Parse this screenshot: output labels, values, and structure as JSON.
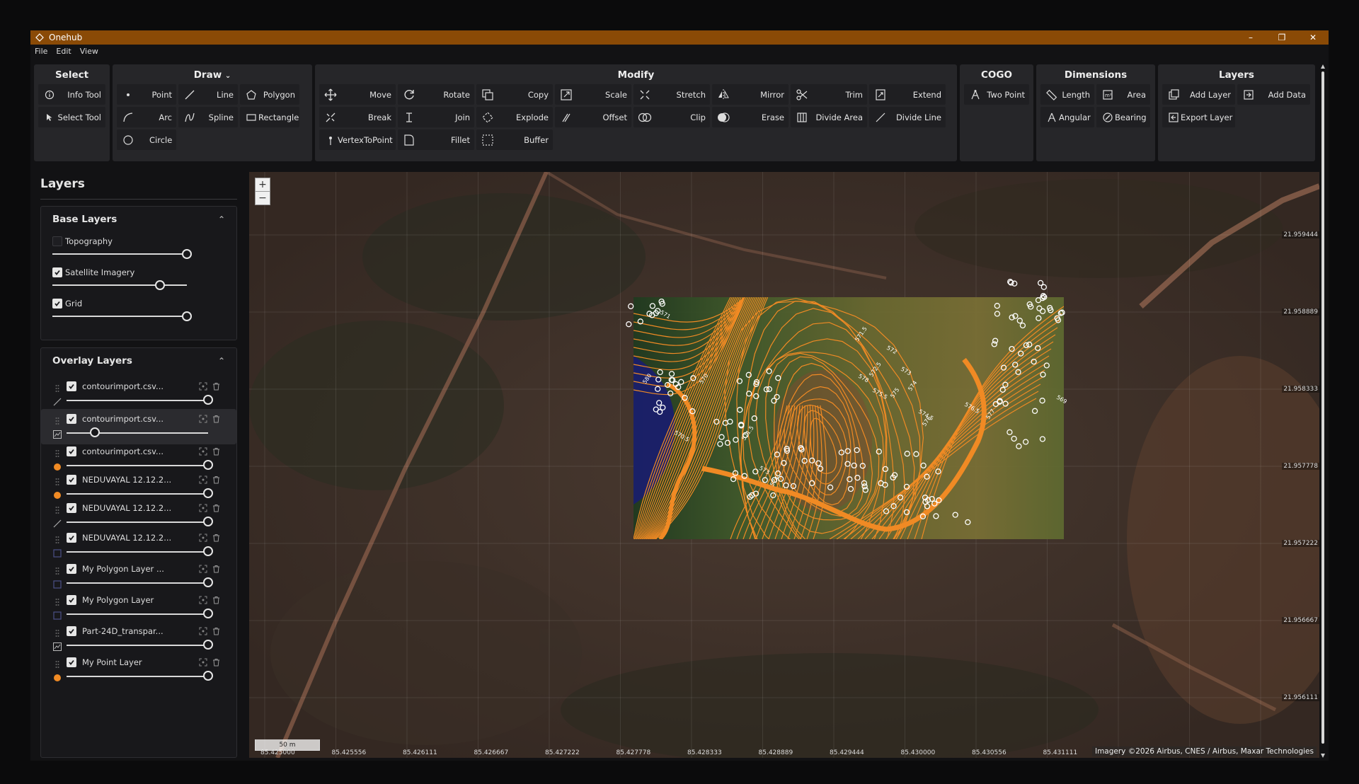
{
  "window": {
    "title": "Onehub",
    "minimize": "–",
    "maximize": "❐",
    "close": "✕"
  },
  "menu": [
    "File",
    "Edit",
    "View"
  ],
  "ribbon": {
    "select": {
      "title": "Select",
      "buttons": [
        "Info Tool",
        "Select Tool"
      ]
    },
    "draw": {
      "title": "Draw",
      "buttons": [
        "Point",
        "Line",
        "Polygon",
        "Arc",
        "Spline",
        "Rectangle",
        "Circle"
      ]
    },
    "modify": {
      "title": "Modify",
      "buttons": [
        "Move",
        "Rotate",
        "Copy",
        "Scale",
        "Stretch",
        "Mirror",
        "Trim",
        "Extend",
        "Break",
        "Join",
        "Explode",
        "Offset",
        "Clip",
        "Erase",
        "Divide Area",
        "Divide Line",
        "VertexToPoint",
        "Fillet",
        "Buffer"
      ]
    },
    "cogo": {
      "title": "COGO",
      "buttons": [
        "Two Point"
      ]
    },
    "dimensions": {
      "title": "Dimensions",
      "buttons": [
        "Length",
        "Area",
        "Angular",
        "Bearing"
      ]
    },
    "layers": {
      "title": "Layers",
      "buttons": [
        "Add Layer",
        "Add Data",
        "Export Layer"
      ]
    }
  },
  "sidebar": {
    "title": "Layers",
    "base": {
      "title": "Base Layers",
      "items": [
        {
          "label": "Topography",
          "checked": false,
          "opacity": 1.0
        },
        {
          "label": "Satellite Imagery",
          "checked": true,
          "opacity": 0.8
        },
        {
          "label": "Grid",
          "checked": true,
          "opacity": 1.0
        }
      ]
    },
    "overlay": {
      "title": "Overlay Layers",
      "items": [
        {
          "label": "contourimport.csv...",
          "type": "line",
          "opacity": 1.0,
          "selected": false
        },
        {
          "label": "contourimport.csv...",
          "type": "raster",
          "opacity": 0.2,
          "selected": true
        },
        {
          "label": "contourimport.csv...",
          "type": "point",
          "opacity": 1.0,
          "selected": false
        },
        {
          "label": "NEDUVAYAL 12.12.2...",
          "type": "point",
          "opacity": 1.0,
          "selected": false
        },
        {
          "label": "NEDUVAYAL 12.12.2...",
          "type": "line",
          "opacity": 1.0,
          "selected": false
        },
        {
          "label": "NEDUVAYAL 12.12.2...",
          "type": "polygon",
          "opacity": 1.0,
          "selected": false
        },
        {
          "label": "My Polygon Layer ...",
          "type": "polygon",
          "opacity": 1.0,
          "selected": false
        },
        {
          "label": "My Polygon Layer",
          "type": "polygon",
          "opacity": 1.0,
          "selected": false
        },
        {
          "label": "Part-24D_transpar...",
          "type": "raster",
          "opacity": 1.0,
          "selected": false
        },
        {
          "label": "My Point Layer",
          "type": "point",
          "opacity": 1.0,
          "selected": false
        }
      ]
    }
  },
  "map": {
    "zoom_in": "+",
    "zoom_out": "−",
    "lat_labels": [
      "21.959444",
      "21.958889",
      "21.958333",
      "21.957778",
      "21.957222",
      "21.956667",
      "21.956111"
    ],
    "lon_labels": [
      "85.425000",
      "85.425556",
      "85.426111",
      "85.426667",
      "85.427222",
      "85.427778",
      "85.428333",
      "85.428889",
      "85.429444",
      "85.430000",
      "85.430556",
      "85.431111"
    ],
    "scale": "50 m",
    "attribution": "Imagery ©2026 Airbus, CNES / Airbus, Maxar Technologies",
    "contour_labels": [
      "571",
      "571.5",
      "572",
      "572.5",
      "573",
      "574",
      "574.5",
      "575",
      "575.5",
      "576",
      "576.5",
      "577",
      "578",
      "580",
      "569",
      "570",
      "570.5",
      "571.5",
      "573",
      "574"
    ]
  },
  "colors": {
    "accent": "#f08a24",
    "titlebar": "#8a4a06",
    "panel": "#18181b"
  }
}
